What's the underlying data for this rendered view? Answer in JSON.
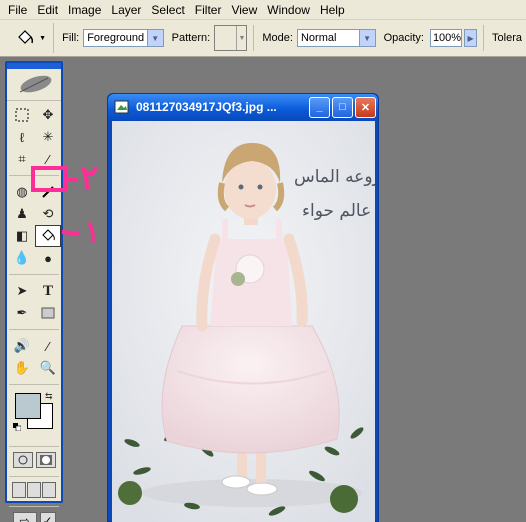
{
  "menu": [
    "File",
    "Edit",
    "Image",
    "Layer",
    "Select",
    "Filter",
    "View",
    "Window",
    "Help"
  ],
  "options": {
    "fill_label": "Fill:",
    "fill_value": "Foreground",
    "pattern_label": "Pattern:",
    "mode_label": "Mode:",
    "mode_value": "Normal",
    "opacity_label": "Opacity:",
    "opacity_value": "100%",
    "tolerance_label": "Tolera"
  },
  "document": {
    "title": "081127034917JQf3.jpg ...",
    "overlay_text_1": "روعه الماس",
    "overlay_text_2": "عالم حواء"
  },
  "annotation": {
    "label_top": "٢",
    "label_bottom": "١"
  },
  "colors": {
    "foreground": "#b9c9cf",
    "background": "#ffffff",
    "annotation": "#ff2d95"
  }
}
